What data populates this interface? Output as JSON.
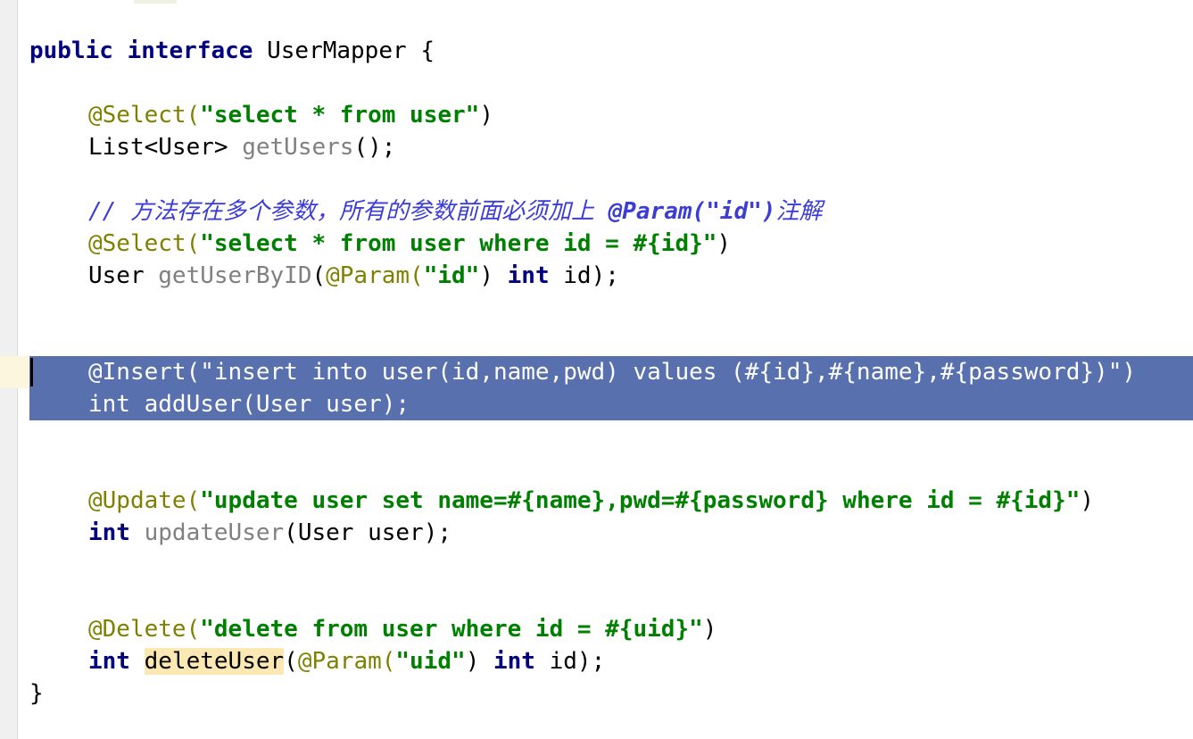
{
  "editor": {
    "interface_line": {
      "kw": "public interface",
      "name": "UserMapper",
      "brace": "{"
    },
    "select_all": {
      "annotation": "@Select(",
      "sql": "\"select * from user\"",
      "close": ")",
      "ret": "List<User>",
      "method": "getUsers",
      "rest": "();"
    },
    "comment": {
      "prefix": "// 方法存在多个参数，所有的参数前面必须加上 ",
      "param": "@Param(\"id\")",
      "suffix": "注解"
    },
    "select_by_id": {
      "annotation": "@Select(",
      "sql": "\"select * from user where id = #{id}\"",
      "close": ")",
      "ret": "User",
      "method": "getUserByID",
      "open": "(",
      "param_ann": "@Param(",
      "param_val": "\"id\"",
      "param_close": ")",
      "type": "int",
      "rest": "id);"
    },
    "insert": {
      "line1": "@Insert(\"insert into user(id,name,pwd) values (#{id},#{name},#{password})\")",
      "line2": "int addUser(User user);"
    },
    "update": {
      "annotation": "@Update(",
      "sql": "\"update user set name=#{name},pwd=#{password} where id = #{id}\"",
      "close": ")",
      "type": "int",
      "method": "updateUser",
      "rest": "(User user);"
    },
    "delete": {
      "annotation": "@Delete(",
      "sql": "\"delete from user where id = #{uid}\"",
      "close": ")",
      "type": "int",
      "method": "deleteUser",
      "open": "(",
      "param_ann": "@Param(",
      "param_val": "\"uid\"",
      "param_close": ")",
      "ptype": "int",
      "rest": "id);"
    },
    "closing_brace": "}"
  },
  "colors": {
    "keyword": "#000080",
    "annotation": "#808000",
    "string": "#008000",
    "comment": "#3c3cd6",
    "selection": "#5870ae",
    "usage_highlight": "#fce8b3"
  }
}
